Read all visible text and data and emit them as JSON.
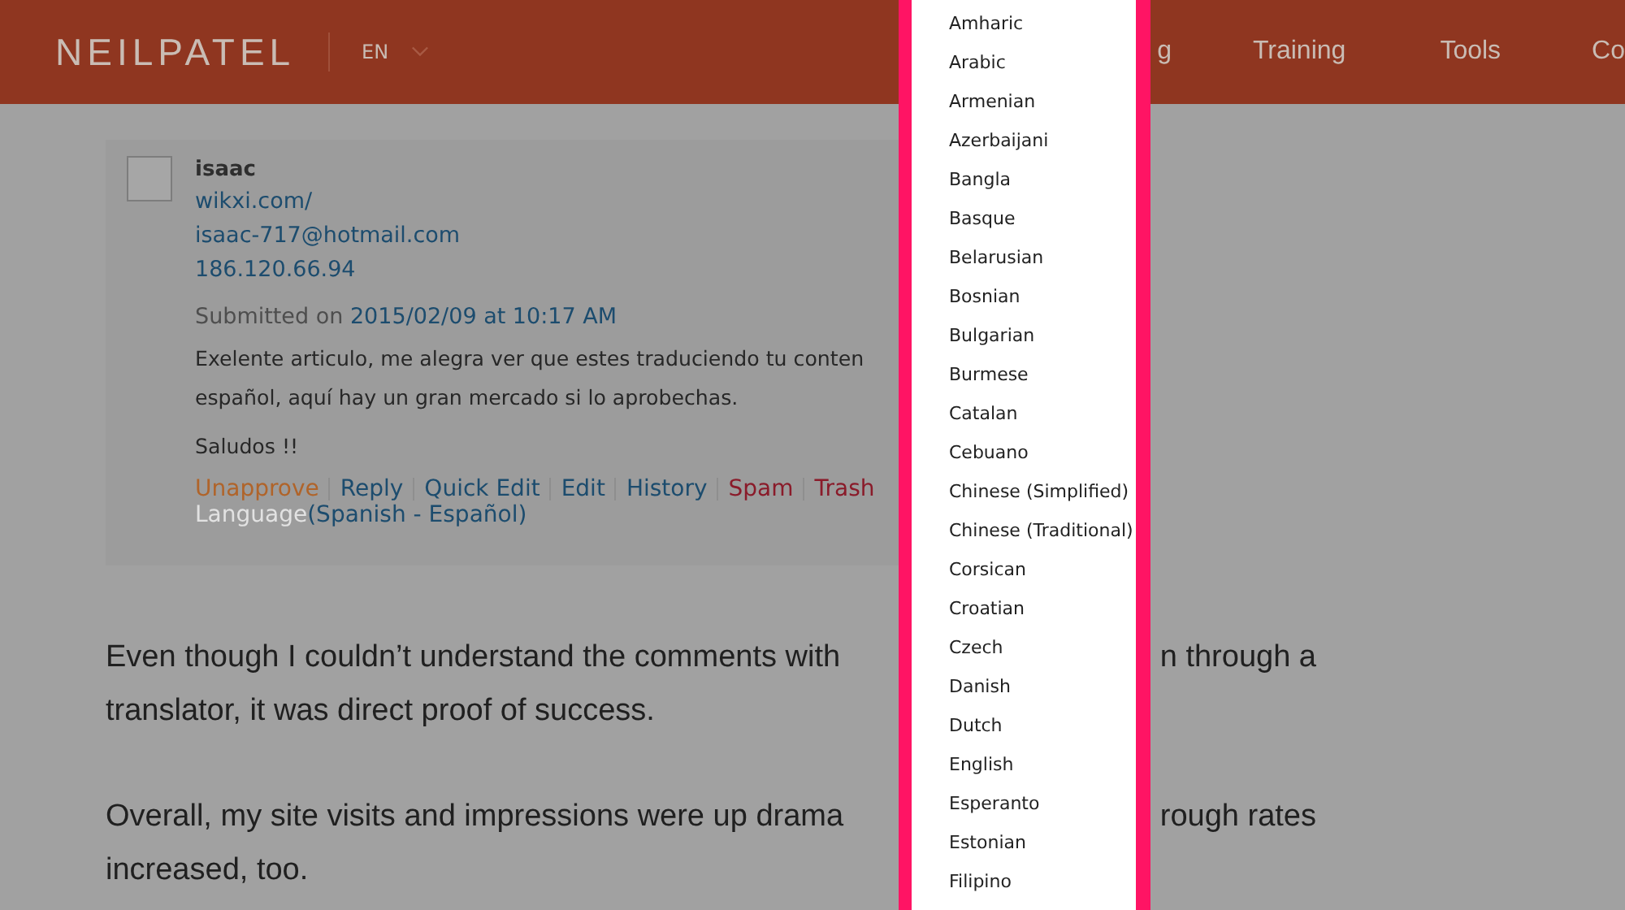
{
  "header": {
    "logo": "NEILPATEL",
    "language": "EN",
    "nav": [
      "g",
      "Training",
      "Tools",
      "Co"
    ]
  },
  "comment": {
    "author": "isaac",
    "url": "wikxi.com/",
    "email": "isaac-717@hotmail.com",
    "ip": "186.120.66.94",
    "submitted_label": "Submitted on",
    "submitted_date": "2015/02/09 at 10:17 AM",
    "body": [
      "Exelente articulo, me alegra ver que estes traduciendo tu conten",
      "español, aquí hay un gran mercado si lo aprobechas.",
      "Saludos !!"
    ],
    "actions": [
      {
        "label": "Unapprove",
        "kind": "approve"
      },
      {
        "label": "Reply",
        "kind": "normal"
      },
      {
        "label": "Quick Edit",
        "kind": "normal"
      },
      {
        "label": "Edit",
        "kind": "normal"
      },
      {
        "label": "History",
        "kind": "normal"
      },
      {
        "label": "Spam",
        "kind": "danger"
      },
      {
        "label": "Trash",
        "kind": "danger"
      }
    ],
    "language_label": "Language",
    "language_value": "(Spanish - Español)"
  },
  "paragraphs": [
    [
      {
        "left": "Even though I couldn’t understand the comments with",
        "right": "n through a"
      },
      {
        "left": "translator, it was direct proof of success."
      }
    ],
    [
      {
        "left": "Overall, my site visits and impressions were up drama",
        "right": "rough rates"
      },
      {
        "left": "increased, too."
      }
    ]
  ],
  "dropdown": {
    "items": [
      "Amharic",
      "Arabic",
      "Armenian",
      "Azerbaijani",
      "Bangla",
      "Basque",
      "Belarusian",
      "Bosnian",
      "Bulgarian",
      "Burmese",
      "Catalan",
      "Cebuano",
      "Chinese (Simplified)",
      "Chinese (Traditional)",
      "Corsican",
      "Croatian",
      "Czech",
      "Danish",
      "Dutch",
      "English",
      "Esperanto",
      "Estonian",
      "Filipino"
    ]
  }
}
